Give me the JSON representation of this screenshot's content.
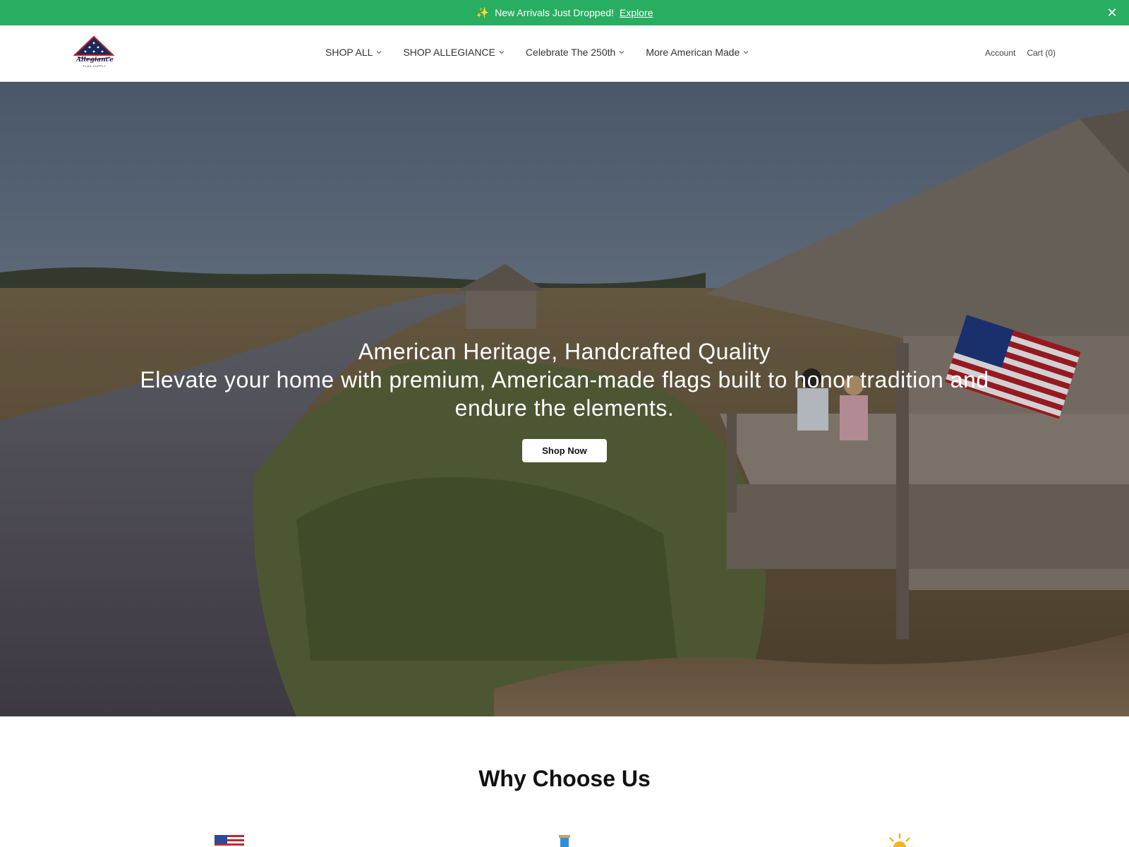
{
  "announcement": {
    "sparkle": "✨",
    "text": "New Arrivals Just Dropped!",
    "link": "Explore",
    "close": "✕"
  },
  "header": {
    "logo_text": "Allegiance",
    "logo_subtext": "FLAG SUPPLY",
    "nav": [
      {
        "label": "SHOP ALL"
      },
      {
        "label": "SHOP ALLEGIANCE"
      },
      {
        "label": "Celebrate The 250th"
      },
      {
        "label": "More American Made"
      }
    ],
    "account": "Account",
    "cart": "Cart (0)"
  },
  "hero": {
    "title": "American Heritage, Handcrafted Quality",
    "subtitle": "Elevate your home with premium, American-made flags built to honor tradition and endure the elements.",
    "button": "Shop Now"
  },
  "why": {
    "title": "Why Choose Us",
    "features": [
      {
        "icon": "us-flag-icon"
      },
      {
        "icon": "thread-spool-icon"
      },
      {
        "icon": "sun-icon"
      }
    ]
  },
  "colors": {
    "announcement_bg": "#27ae60",
    "logo_navy": "#1c2a5a",
    "logo_red": "#b3202a"
  }
}
